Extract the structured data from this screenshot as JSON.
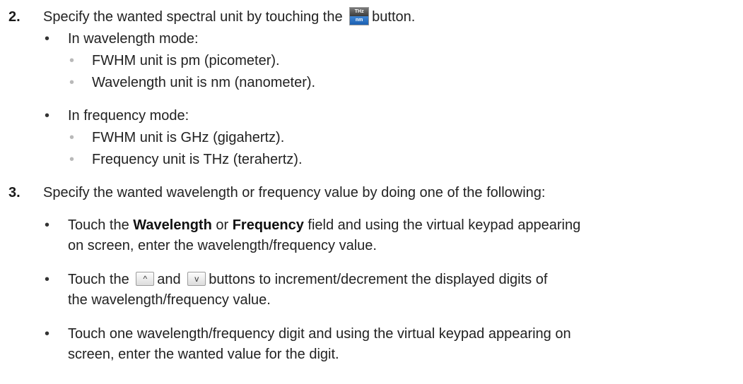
{
  "steps": [
    {
      "number": "2.",
      "text_before": "Specify the wanted spectral unit by touching the",
      "text_after": "button.",
      "unit_button": {
        "top_label": "THz",
        "bottom_label": "nm"
      },
      "bullets": [
        {
          "text": "In wavelength mode:",
          "sub": [
            "FWHM unit is pm (picometer).",
            "Wavelength unit is nm (nanometer)."
          ]
        },
        {
          "text": "In frequency mode:",
          "sub": [
            "FWHM unit is GHz (gigahertz).",
            "Frequency unit is THz (terahertz)."
          ]
        }
      ]
    },
    {
      "number": "3.",
      "text": "Specify the wanted wavelength or frequency value by doing one of the following:",
      "bullets": [
        {
          "line1_a": "Touch the ",
          "kw1": "Wavelength",
          "line1_b": " or ",
          "kw2": "Frequency",
          "line1_c": " field and using the virtual keypad appearing",
          "line2": "on screen, enter the wavelength/frequency value."
        },
        {
          "line1_a": "Touch the",
          "line1_b": "and",
          "line1_c": "buttons to increment/decrement the displayed digits of",
          "line2": "the wavelength/frequency value.",
          "up_glyph": "^",
          "down_glyph": "v"
        },
        {
          "line1": "Touch one wavelength/frequency digit and using the virtual keypad appearing on",
          "line2": "screen, enter the wanted value for the digit."
        }
      ]
    }
  ]
}
